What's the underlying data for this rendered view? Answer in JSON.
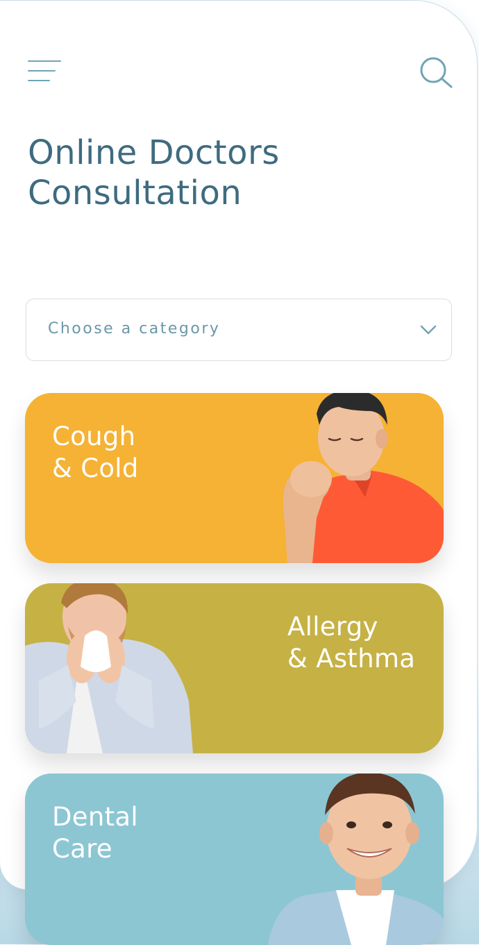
{
  "header": {
    "menu_icon": "hamburger-menu-icon",
    "search_icon": "search-icon"
  },
  "title": {
    "line1": "Online Doctors",
    "line2": "Consultation"
  },
  "category_select": {
    "placeholder": "Choose a category",
    "icon": "chevron-down-icon"
  },
  "categories": [
    {
      "line1": "Cough",
      "line2": "& Cold",
      "color": "#f5b234"
    },
    {
      "line1": "Allergy",
      "line2": "& Asthma",
      "color": "#c6b145"
    },
    {
      "line1": "Dental",
      "line2": "Care",
      "color": "#8cc6d3"
    }
  ],
  "colors": {
    "primary_text": "#3e6b80",
    "accent": "#6fa3b6"
  }
}
